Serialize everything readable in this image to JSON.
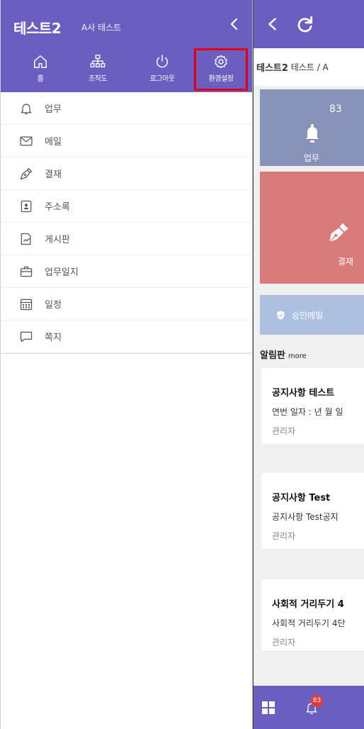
{
  "drawer": {
    "title": "테스트2",
    "subtitle": "A사 테스트",
    "quick_actions": [
      {
        "label": "홈",
        "icon": "home-icon"
      },
      {
        "label": "조직도",
        "icon": "org-chart-icon"
      },
      {
        "label": "로그아웃",
        "icon": "power-icon"
      },
      {
        "label": "환경설정",
        "icon": "gear-icon"
      }
    ],
    "menu": [
      {
        "label": "업무",
        "icon": "bell-icon"
      },
      {
        "label": "메일",
        "icon": "mail-icon"
      },
      {
        "label": "결재",
        "icon": "pen-icon"
      },
      {
        "label": "주소록",
        "icon": "contact-book-icon"
      },
      {
        "label": "게시판",
        "icon": "board-icon"
      },
      {
        "label": "업무일지",
        "icon": "briefcase-icon"
      },
      {
        "label": "일정",
        "icon": "calendar-icon"
      },
      {
        "label": "쪽지",
        "icon": "message-icon"
      }
    ]
  },
  "main": {
    "breadcrumb": {
      "current": "테스트2",
      "path": "테스트 / A"
    },
    "cards": {
      "task": {
        "count": "83",
        "label": "업무"
      },
      "approval": {
        "label": "결재"
      },
      "mail": {
        "label": "승인메일"
      }
    },
    "board": {
      "title": "알림판",
      "more": "more"
    },
    "notices": [
      {
        "title": "공지사항 테스트",
        "body": "연번 일자 : 년 월 일",
        "author": "관리자"
      },
      {
        "title": "공지사항 Test",
        "body": "공지사항 Test공지",
        "author": "관리자"
      },
      {
        "title": "사회적 거리두기 4",
        "body": "사회적 거리두기 4단",
        "author": "관리자"
      }
    ],
    "bottom_nav": {
      "badge": "83"
    }
  },
  "colors": {
    "primary": "#6c5ec0",
    "highlight": "#e3000f",
    "task_card": "#8891b8",
    "approval_card": "#d97a7a",
    "mail_card": "#aec0df"
  }
}
